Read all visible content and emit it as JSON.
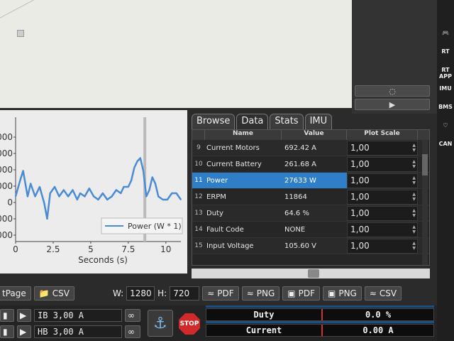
{
  "tabs": [
    "Browse",
    "Data",
    "Stats",
    "IMU"
  ],
  "table": {
    "headers": [
      "Name",
      "Value",
      "Plot Scale"
    ],
    "rows": [
      {
        "idx": "9",
        "name": "Current Motors",
        "value": "692.42 A",
        "scale": "1,00"
      },
      {
        "idx": "10",
        "name": "Current Battery",
        "value": "261.68 A",
        "scale": "1,00"
      },
      {
        "idx": "11",
        "name": "Power",
        "value": "27633 W",
        "scale": "1,00",
        "selected": true
      },
      {
        "idx": "12",
        "name": "ERPM",
        "value": "11864",
        "scale": "1,00"
      },
      {
        "idx": "13",
        "name": "Duty",
        "value": "64.6 %",
        "scale": "1,00"
      },
      {
        "idx": "14",
        "name": "Fault Code",
        "value": "NONE",
        "scale": "1,00"
      },
      {
        "idx": "15",
        "name": "Input Voltage",
        "value": "105.60 V",
        "scale": "1,00"
      }
    ]
  },
  "chart_data": {
    "type": "line",
    "xlabel": "Seconds (s)",
    "xticks": [
      "0",
      "2.5",
      "5",
      "7.5",
      "10"
    ],
    "yticks": [
      "000",
      "000",
      "000",
      "000",
      "0",
      "000",
      "000"
    ],
    "xlim": [
      0,
      11
    ],
    "series": [
      {
        "name": "Power (W * 1)",
        "color": "#4a8bd4",
        "x": [
          0,
          0.3,
          0.5,
          0.8,
          1.0,
          1.3,
          1.6,
          1.9,
          2.1,
          2.3,
          2.6,
          2.9,
          3.2,
          3.5,
          3.8,
          4.1,
          4.3,
          4.6,
          4.9,
          5.2,
          5.5,
          5.8,
          6.1,
          6.4,
          6.7,
          7.0,
          7.2,
          7.5,
          7.7,
          7.9,
          8.1,
          8.3,
          8.5,
          8.7,
          8.9,
          9.1,
          9.3,
          9.5,
          9.8,
          10.1,
          10.4,
          10.7,
          11.0
        ],
        "y": [
          0.1,
          0.6,
          0.9,
          0.1,
          0.5,
          0.1,
          0.4,
          -0.1,
          -0.6,
          0.2,
          0.4,
          0.1,
          0.3,
          0.1,
          0.3,
          0.0,
          0.2,
          0.1,
          0.35,
          0.1,
          0.0,
          0.2,
          0.0,
          0.1,
          0.3,
          0.2,
          0.4,
          0.4,
          0.6,
          1.0,
          1.2,
          1.3,
          0.9,
          0.1,
          0.3,
          0.7,
          0.5,
          0.1,
          0.0,
          0.0,
          0.2,
          0.2,
          0.0
        ]
      }
    ]
  },
  "side_buttons": {
    "top_icon": "◌",
    "play_icon": "▶"
  },
  "toolbar": [
    "RT",
    "RT APP",
    "IMU",
    "BMS",
    "♡",
    "CAN"
  ],
  "export_bar": {
    "page_label": "tPage",
    "csv_label": "CSV",
    "width_label": "W:",
    "width_value": "1280",
    "height_label": "H:",
    "height_value": "720",
    "pdf1": "PDF",
    "png1": "PNG",
    "pdf2": "PDF",
    "png2": "PNG",
    "csv2": "CSV"
  },
  "controls": {
    "ib_label": "IB",
    "ib_value": "3,00 A",
    "hb_label": "HB",
    "hb_value": "3,00 A",
    "stop_label": "STOP"
  },
  "gauges": [
    {
      "label": "Duty",
      "value": "0.0 %"
    },
    {
      "label": "Current",
      "value": "0.00 A"
    }
  ]
}
